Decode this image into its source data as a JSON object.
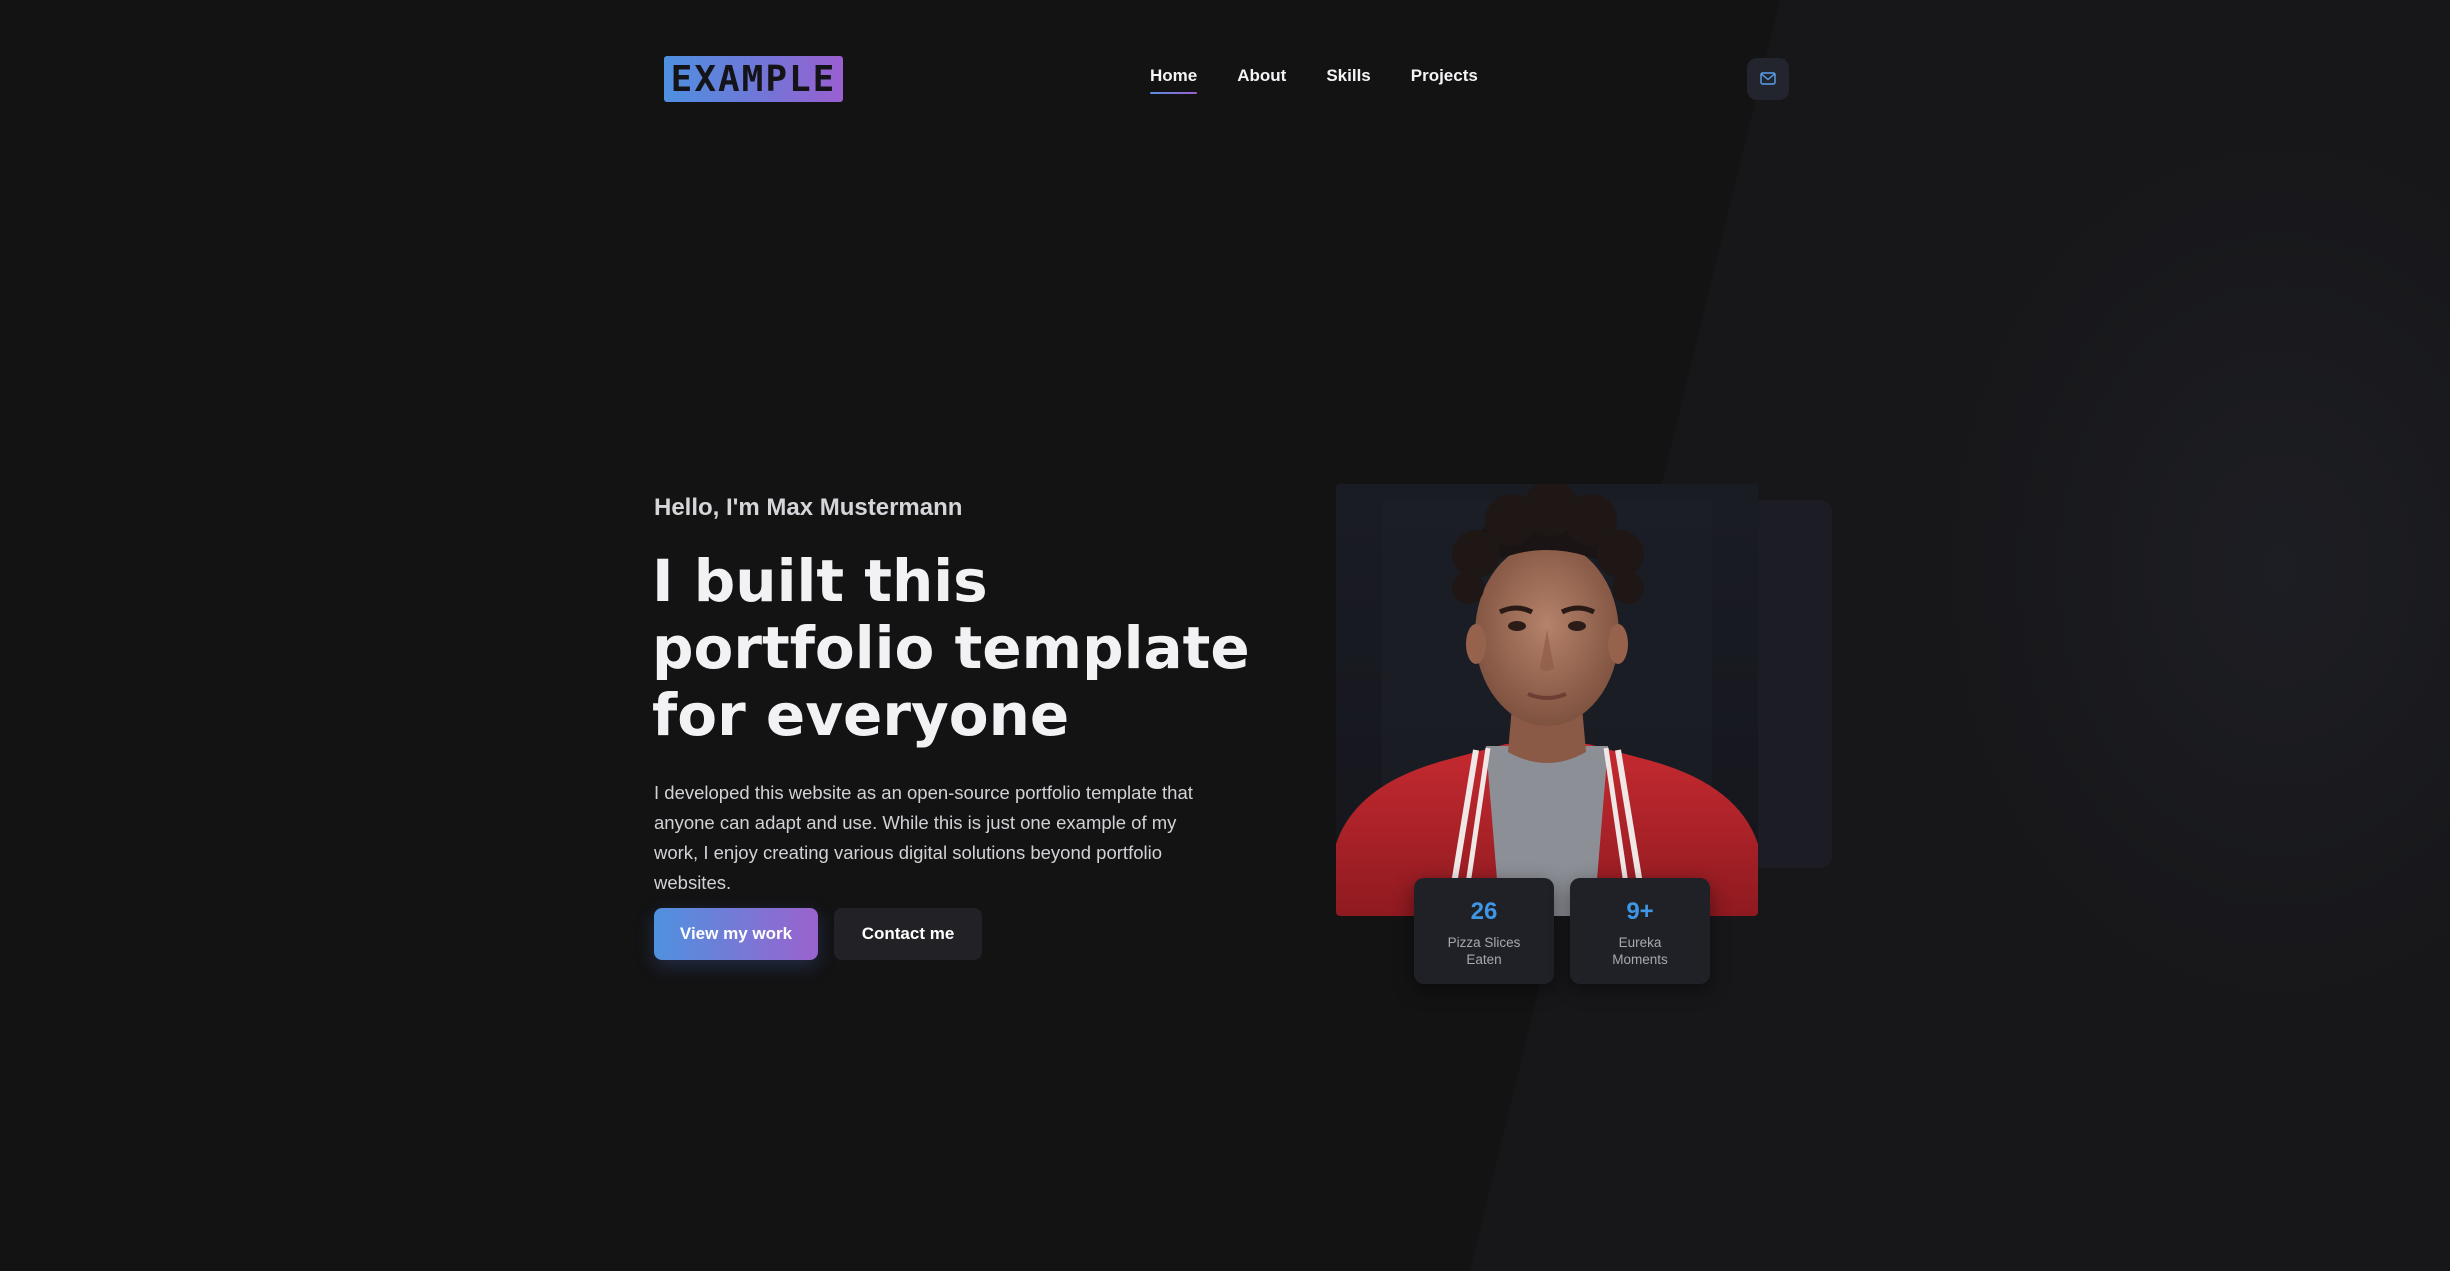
{
  "header": {
    "logo_text": "EXAMPLE",
    "nav": [
      {
        "label": "Home",
        "active": true
      },
      {
        "label": "About",
        "active": false
      },
      {
        "label": "Skills",
        "active": false
      },
      {
        "label": "Projects",
        "active": false
      }
    ],
    "contact_icon": "mail-icon"
  },
  "hero": {
    "greeting": "Hello, I'm Max Mustermann",
    "headline": "I built this portfolio template for everyone",
    "description": "I developed this website as an open-source portfolio template that anyone can adapt and use. While this is just one example of my work, I enjoy creating various digital solutions beyond portfolio websites.",
    "primary_button": "View my work",
    "secondary_button": "Contact me"
  },
  "stats": [
    {
      "value": "26",
      "label": "Pizza Slices Eaten"
    },
    {
      "value": "9+",
      "label": "Eureka Moments"
    }
  ],
  "colors": {
    "background": "#131314",
    "accent_blue": "#4f91de",
    "accent_purple": "#9b62cd",
    "stat_value": "#3f96e4"
  }
}
